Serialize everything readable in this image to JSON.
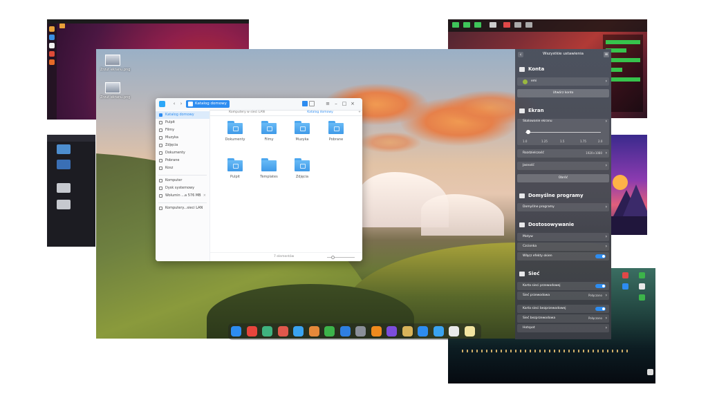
{
  "desktop": {
    "icons": [
      {
        "label": "Zrzut ekranu.png"
      },
      {
        "label": "Zrzut ekranu.png"
      }
    ]
  },
  "file_manager": {
    "breadcrumb": "Katalog domowy",
    "tabs": [
      "Komputery w sieci LAN",
      "Katalog domowy"
    ],
    "sidebar": [
      {
        "label": "Katalog domowy",
        "icon": "home-icon",
        "active": true
      },
      {
        "label": "Pulpit",
        "icon": "desktop-icon"
      },
      {
        "label": "Filmy",
        "icon": "video-icon"
      },
      {
        "label": "Muzyka",
        "icon": "music-icon"
      },
      {
        "label": "Zdjęcia",
        "icon": "image-icon"
      },
      {
        "label": "Dokumenty",
        "icon": "document-icon"
      },
      {
        "label": "Pobrane",
        "icon": "download-icon"
      },
      {
        "label": "Kosz",
        "icon": "trash-icon"
      },
      {
        "label": "Komputer",
        "icon": "computer-icon"
      },
      {
        "label": "Dysk systemowy",
        "icon": "disk-icon"
      },
      {
        "label": "Wolumin ...a 576 MB",
        "icon": "volume-icon"
      },
      {
        "label": "Komputery...sieci LAN",
        "icon": "network-icon"
      }
    ],
    "folders": [
      {
        "label": "Dokumenty"
      },
      {
        "label": "Filmy"
      },
      {
        "label": "Muzyka"
      },
      {
        "label": "Pobrane"
      },
      {
        "label": "Pulpit"
      },
      {
        "label": "Templates"
      },
      {
        "label": "Zdjęcia"
      }
    ],
    "status": "7 elementów"
  },
  "dock": {
    "icons": [
      {
        "name": "launcher-icon",
        "color": "#2d8cf0"
      },
      {
        "name": "chrome-icon",
        "color": "#e8453c"
      },
      {
        "name": "file-manager-icon",
        "color": "#3fb27f"
      },
      {
        "name": "screenshot-icon",
        "color": "#e0584c"
      },
      {
        "name": "store-icon",
        "color": "#3aa3f0"
      },
      {
        "name": "archive-icon",
        "color": "#e5893a"
      },
      {
        "name": "editor-icon",
        "color": "#3cb44a"
      },
      {
        "name": "video-player-icon",
        "color": "#2e7fe0"
      },
      {
        "name": "settings-icon",
        "color": "#8a8f99"
      },
      {
        "name": "vlc-icon",
        "color": "#f08a1d"
      },
      {
        "name": "power-icon",
        "color": "#7c4ddc"
      },
      {
        "name": "clock-icon",
        "color": "#d8b35a"
      },
      {
        "name": "wifi-icon",
        "color": "#2d8cf0"
      },
      {
        "name": "storage-icon",
        "color": "#3aa3f0"
      },
      {
        "name": "keyboard-icon",
        "color": "#e9e9e9"
      },
      {
        "name": "trash-icon",
        "color": "#f2e4a0"
      }
    ]
  },
  "settings": {
    "title": "Wszystkie ustawienia",
    "konta": {
      "title": "Konta",
      "user": "emi",
      "button": "Utwórz konto"
    },
    "ekran": {
      "title": "Ekran",
      "scaling_label": "Skalowanie ekranu",
      "scale_ticks": [
        "1.0",
        "1.25",
        "1.5",
        "1.75",
        "2.0"
      ],
      "resolution_label": "Rozdzielczość",
      "resolution_value": "1920×1080",
      "brightness_label": "Jasność",
      "button": "Obróć"
    },
    "programy": {
      "title": "Domyślne programy",
      "row": "Domyślne programy"
    },
    "dostosowywanie": {
      "title": "Dostosowywanie",
      "rows": [
        "Motyw",
        "Czcionka"
      ],
      "effects_label": "Włącz efekty okien"
    },
    "siec": {
      "title": "Sieć",
      "wired_card": "Karta sieci przewodowej",
      "wired": "Sieć przewodowa",
      "wired_status": "Połączono",
      "wireless_card": "Karta sieci bezprzewodowej",
      "wireless": "Sieć bezprzewodowa",
      "wireless_status": "Połączono",
      "hotspot": "Hotspot"
    }
  }
}
